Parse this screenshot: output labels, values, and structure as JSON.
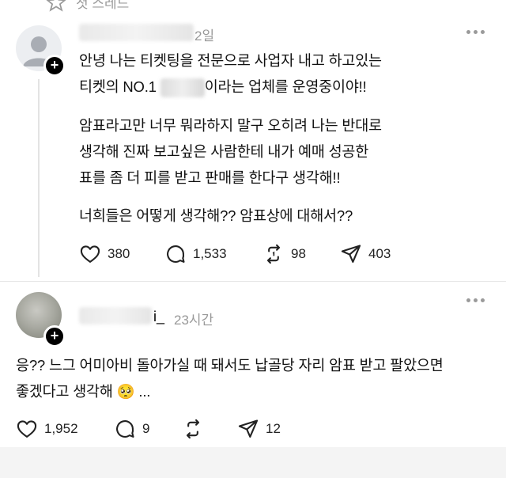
{
  "top": {
    "label": "첫 스레드",
    "icon": "star-icon"
  },
  "post1": {
    "time": "2일",
    "text": {
      "p1_line1": "안녕 나는 티켓팅을 전문으로 사업자 내고 하고있는",
      "p1_line2_pre": "티켓의 NO.1 ",
      "p1_line2_post": "이라는 업체를 운영중이야!!",
      "p2_line1": "암표라고만 너무 뭐라하지 말구 오히려 나는 반대로",
      "p2_line2": "생각해 진짜 보고싶은 사람한테 내가 예매 성공한",
      "p2_line3": "표를 좀 더 피를 받고 판매를 한다구 생각해!!",
      "p3_line1": "너희들은 어떻게 생각해?? 암표상에 대해서??"
    },
    "likes": "380",
    "comments": "1,533",
    "reposts": "98",
    "shares": "403"
  },
  "post2": {
    "username_suffix": "i_",
    "time": "23시간",
    "text": {
      "line1": "응?? 느그 어미아비 돌아가실 때 돼서도 납골당 자리 암표 받고 팔았으면",
      "line2": "좋겠다고 생각해 🥺 ..."
    },
    "likes": "1,952",
    "comments": "9",
    "shares": "12"
  },
  "icons": [
    "heart-icon",
    "comment-icon",
    "repost-icon",
    "share-icon",
    "more-icon",
    "plus-icon"
  ]
}
